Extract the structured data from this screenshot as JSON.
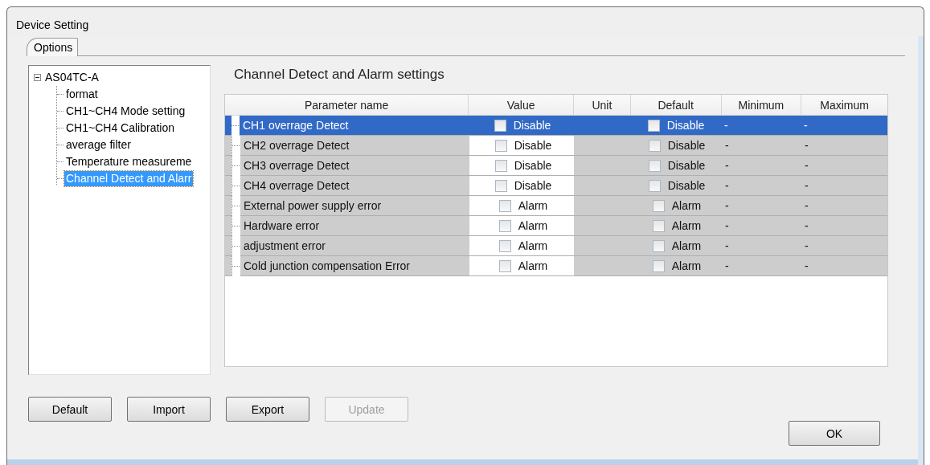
{
  "window": {
    "title": "Device Setting"
  },
  "tabs": [
    {
      "label": "Options",
      "selected": true
    }
  ],
  "tree": {
    "label": "AS04TC-A",
    "expanded": true,
    "children": [
      {
        "label": "format",
        "selected": false
      },
      {
        "label": "CH1~CH4 Mode setting",
        "selected": false
      },
      {
        "label": "CH1~CH4 Calibration",
        "selected": false
      },
      {
        "label": "average filter",
        "selected": false
      },
      {
        "label": "Temperature measureme",
        "selected": false
      },
      {
        "label": "Channel Detect and Alarr",
        "selected": true
      }
    ]
  },
  "panel_title": "Channel Detect and Alarm settings",
  "table": {
    "columns": [
      "Parameter name",
      "Value",
      "Unit",
      "Default",
      "Minimum",
      "Maximum"
    ],
    "rows": [
      {
        "name": "CH1 overrage Detect",
        "selected": true,
        "value": {
          "label": "Disable",
          "checked": false
        },
        "default": {
          "label": "Disable",
          "checked": false
        },
        "minimum": "-",
        "maximum": "-"
      },
      {
        "name": "CH2 overrage Detect",
        "selected": false,
        "value": {
          "label": "Disable",
          "checked": false
        },
        "default": {
          "label": "Disable",
          "checked": false
        },
        "minimum": "-",
        "maximum": "-"
      },
      {
        "name": "CH3 overrage Detect",
        "selected": false,
        "value": {
          "label": "Disable",
          "checked": false
        },
        "default": {
          "label": "Disable",
          "checked": false
        },
        "minimum": "-",
        "maximum": "-"
      },
      {
        "name": "CH4 overrage Detect",
        "selected": false,
        "value": {
          "label": "Disable",
          "checked": false
        },
        "default": {
          "label": "Disable",
          "checked": false
        },
        "minimum": "-",
        "maximum": "-"
      },
      {
        "name": "External power supply error",
        "selected": false,
        "value": {
          "label": "Alarm",
          "checked": false
        },
        "default": {
          "label": "Alarm",
          "checked": false
        },
        "minimum": "-",
        "maximum": "-"
      },
      {
        "name": "Hardware error",
        "selected": false,
        "value": {
          "label": "Alarm",
          "checked": false
        },
        "default": {
          "label": "Alarm",
          "checked": false
        },
        "minimum": "-",
        "maximum": "-"
      },
      {
        "name": "adjustment error",
        "selected": false,
        "value": {
          "label": "Alarm",
          "checked": false
        },
        "default": {
          "label": "Alarm",
          "checked": false
        },
        "minimum": "-",
        "maximum": "-"
      },
      {
        "name": "Cold junction compensation Error",
        "selected": false,
        "value": {
          "label": "Alarm",
          "checked": false
        },
        "default": {
          "label": "Alarm",
          "checked": false
        },
        "minimum": "-",
        "maximum": "-"
      }
    ]
  },
  "buttons": [
    {
      "label": "Default",
      "disabled": false
    },
    {
      "label": "Import",
      "disabled": false
    },
    {
      "label": "Export",
      "disabled": false
    },
    {
      "label": "Update",
      "disabled": true
    }
  ],
  "ok_button": {
    "label": "OK",
    "disabled": false
  }
}
